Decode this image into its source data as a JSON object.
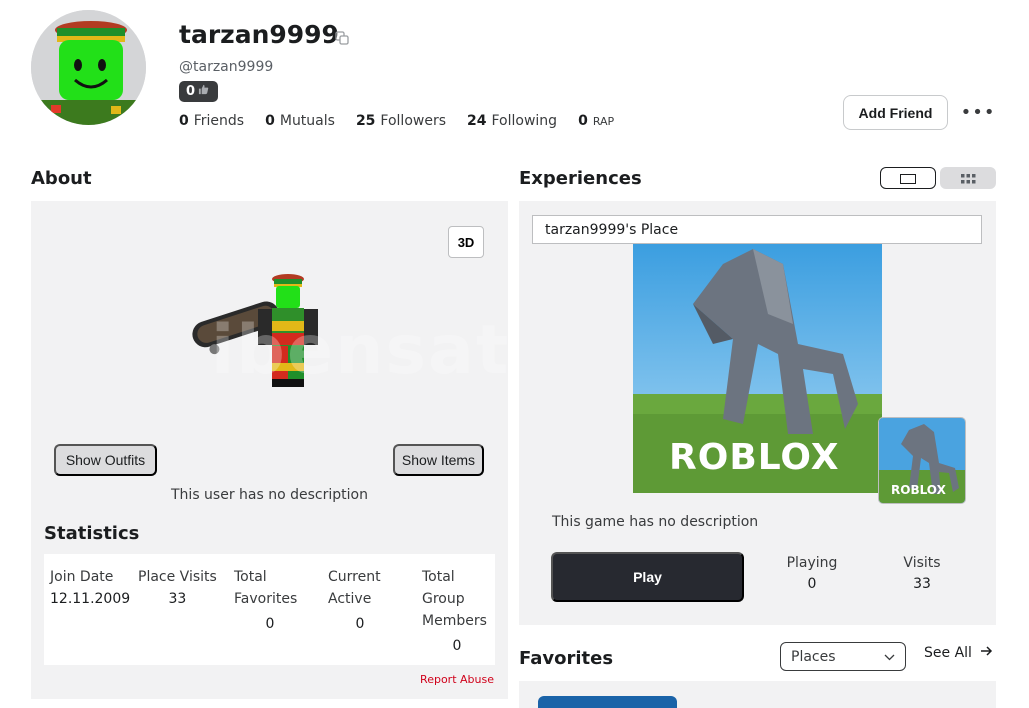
{
  "profile": {
    "display_name": "tarzan9999",
    "handle": "@tarzan9999",
    "reputation": "0",
    "stats": [
      {
        "value": "0",
        "label": "Friends"
      },
      {
        "value": "0",
        "label": "Mutuals"
      },
      {
        "value": "25",
        "label": "Followers"
      },
      {
        "value": "24",
        "label": "Following"
      },
      {
        "value": "0",
        "label": "RAP"
      }
    ],
    "add_friend_label": "Add Friend",
    "more_label": "•••"
  },
  "about": {
    "title": "About",
    "btn_3d": "3D",
    "show_outfits": "Show Outfits",
    "show_items": "Show Items",
    "no_description": "This user has no description",
    "watermark": "ibensatis"
  },
  "statistics": {
    "title": "Statistics",
    "columns": [
      {
        "label": "Join Date",
        "value": "12.11.2009"
      },
      {
        "label": "Place Visits",
        "value": "33"
      },
      {
        "label": "Total Favorites",
        "value": "0"
      },
      {
        "label": "Current Active",
        "value": "0"
      },
      {
        "label": "Total Group Members",
        "value": "0"
      }
    ],
    "report_abuse": "Report Abuse"
  },
  "experiences": {
    "title": "Experiences",
    "place_title": "tarzan9999's Place",
    "thumb_logo": "ROBLOX",
    "game_description": "This game has no description",
    "play_label": "Play",
    "playing_label": "Playing",
    "playing_value": "0",
    "visits_label": "Visits",
    "visits_value": "33"
  },
  "favorites": {
    "title": "Favorites",
    "filter_selected": "Places",
    "see_all": "See All"
  },
  "colors": {
    "accent_dark": "#272930",
    "panel_bg": "#f2f2f3",
    "report_red": "#d0021b"
  }
}
